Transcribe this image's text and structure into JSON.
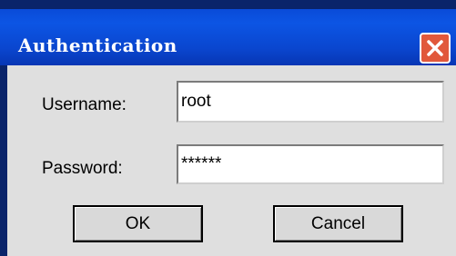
{
  "dialog": {
    "title": "Authentication",
    "close_icon": "close-icon",
    "username_label": "Username:",
    "username_value": "root",
    "password_label": "Password:",
    "password_value": "******",
    "ok_label": "OK",
    "cancel_label": "Cancel"
  },
  "colors": {
    "titlebar": "#0a4bd8",
    "close_button": "#e1583b",
    "client_background": "#dfdfdf"
  }
}
